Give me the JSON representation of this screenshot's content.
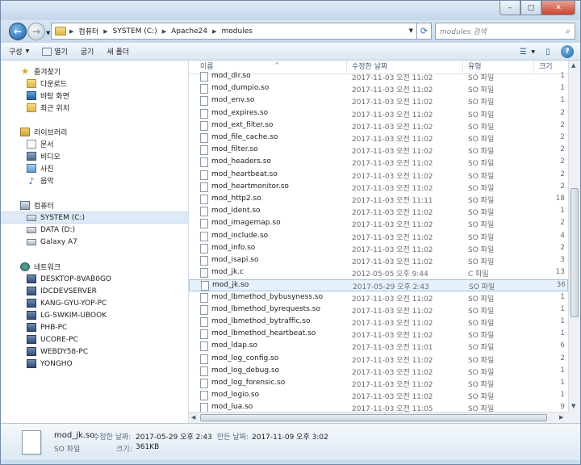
{
  "window": {
    "buttons": {
      "minimize": "–",
      "maximize": "□",
      "close": "✕"
    }
  },
  "address": {
    "crumbs": [
      "컴퓨터",
      "SYSTEM (C:)",
      "Apache24",
      "modules"
    ],
    "search_placeholder": "modules 검색"
  },
  "toolbar": {
    "organize": "구성",
    "open": "열기",
    "share": "굽기",
    "new_folder": "새 폴더"
  },
  "nav": {
    "favorites": {
      "label": "즐겨찾기",
      "items": [
        "다운로드",
        "바탕 화면",
        "최근 위치"
      ]
    },
    "libraries": {
      "label": "라이브러리",
      "items": [
        "문서",
        "비디오",
        "사진",
        "음악"
      ]
    },
    "computer": {
      "label": "컴퓨터",
      "items": [
        "SYSTEM (C:)",
        "DATA (D:)",
        "Galaxy A7"
      ]
    },
    "network": {
      "label": "네트워크",
      "items": [
        "DESKTOP-8VAB0GO",
        "IDCDEVSERVER",
        "KANG-GYU-YOP-PC",
        "LG-SWKIM-UBOOK",
        "PHB-PC",
        "UCORE-PC",
        "WEBDY58-PC",
        "YONGHO"
      ]
    }
  },
  "columns": {
    "name": "이름",
    "date": "수정한 날짜",
    "type": "유형",
    "size": "크기"
  },
  "files": [
    {
      "name": "mod_dir.so",
      "date": "2017-11-03 오전 11:02",
      "type": "SO 파일",
      "size": "1"
    },
    {
      "name": "mod_dumpio.so",
      "date": "2017-11-03 오전 11:02",
      "type": "SO 파일",
      "size": "1"
    },
    {
      "name": "mod_env.so",
      "date": "2017-11-03 오전 11:02",
      "type": "SO 파일",
      "size": "1"
    },
    {
      "name": "mod_expires.so",
      "date": "2017-11-03 오전 11:02",
      "type": "SO 파일",
      "size": "2"
    },
    {
      "name": "mod_ext_filter.so",
      "date": "2017-11-03 오전 11:02",
      "type": "SO 파일",
      "size": "2"
    },
    {
      "name": "mod_file_cache.so",
      "date": "2017-11-03 오전 11:02",
      "type": "SO 파일",
      "size": "2"
    },
    {
      "name": "mod_filter.so",
      "date": "2017-11-03 오전 11:02",
      "type": "SO 파일",
      "size": "2"
    },
    {
      "name": "mod_headers.so",
      "date": "2017-11-03 오전 11:02",
      "type": "SO 파일",
      "size": "2"
    },
    {
      "name": "mod_heartbeat.so",
      "date": "2017-11-03 오전 11:02",
      "type": "SO 파일",
      "size": "2"
    },
    {
      "name": "mod_heartmonitor.so",
      "date": "2017-11-03 오전 11:02",
      "type": "SO 파일",
      "size": "2"
    },
    {
      "name": "mod_http2.so",
      "date": "2017-11-03 오전 11:11",
      "type": "SO 파일",
      "size": "18"
    },
    {
      "name": "mod_ident.so",
      "date": "2017-11-03 오전 11:02",
      "type": "SO 파일",
      "size": "1"
    },
    {
      "name": "mod_imagemap.so",
      "date": "2017-11-03 오전 11:02",
      "type": "SO 파일",
      "size": "2"
    },
    {
      "name": "mod_include.so",
      "date": "2017-11-03 오전 11:02",
      "type": "SO 파일",
      "size": "4"
    },
    {
      "name": "mod_info.so",
      "date": "2017-11-03 오전 11:02",
      "type": "SO 파일",
      "size": "2"
    },
    {
      "name": "mod_isapi.so",
      "date": "2017-11-03 오전 11:02",
      "type": "SO 파일",
      "size": "3"
    },
    {
      "name": "mod_jk.c",
      "date": "2012-05-05 오후 9:44",
      "type": "C 파일",
      "size": "13"
    },
    {
      "name": "mod_jk.so",
      "date": "2017-05-29 오후 2:43",
      "type": "SO 파일",
      "size": "36",
      "selected": true
    },
    {
      "name": "mod_lbmethod_bybusyness.so",
      "date": "2017-11-03 오전 11:02",
      "type": "SO 파일",
      "size": "1"
    },
    {
      "name": "mod_lbmethod_byrequests.so",
      "date": "2017-11-03 오전 11:02",
      "type": "SO 파일",
      "size": "1"
    },
    {
      "name": "mod_lbmethod_bytraffic.so",
      "date": "2017-11-03 오전 11:02",
      "type": "SO 파일",
      "size": "1"
    },
    {
      "name": "mod_lbmethod_heartbeat.so",
      "date": "2017-11-03 오전 11:02",
      "type": "SO 파일",
      "size": "1"
    },
    {
      "name": "mod_ldap.so",
      "date": "2017-11-03 오전 11:01",
      "type": "SO 파일",
      "size": "6"
    },
    {
      "name": "mod_log_config.so",
      "date": "2017-11-03 오전 11:02",
      "type": "SO 파일",
      "size": "2"
    },
    {
      "name": "mod_log_debug.so",
      "date": "2017-11-03 오전 11:02",
      "type": "SO 파일",
      "size": "1"
    },
    {
      "name": "mod_log_forensic.so",
      "date": "2017-11-03 오전 11:02",
      "type": "SO 파일",
      "size": "1"
    },
    {
      "name": "mod_logio.so",
      "date": "2017-11-03 오전 11:02",
      "type": "SO 파일",
      "size": "1"
    },
    {
      "name": "mod_lua.so",
      "date": "2017-11-03 오전 11:05",
      "type": "SO 파일",
      "size": "9"
    }
  ],
  "details": {
    "name": "mod_jk.so",
    "type": "SO 파일",
    "modified_label": "수정한 날짜:",
    "modified_value": "2017-05-29 오후 2:43",
    "created_label": "만든 날짜:",
    "created_value": "2017-11-09 오후 3:02",
    "size_label": "크기:",
    "size_value": "361KB"
  }
}
